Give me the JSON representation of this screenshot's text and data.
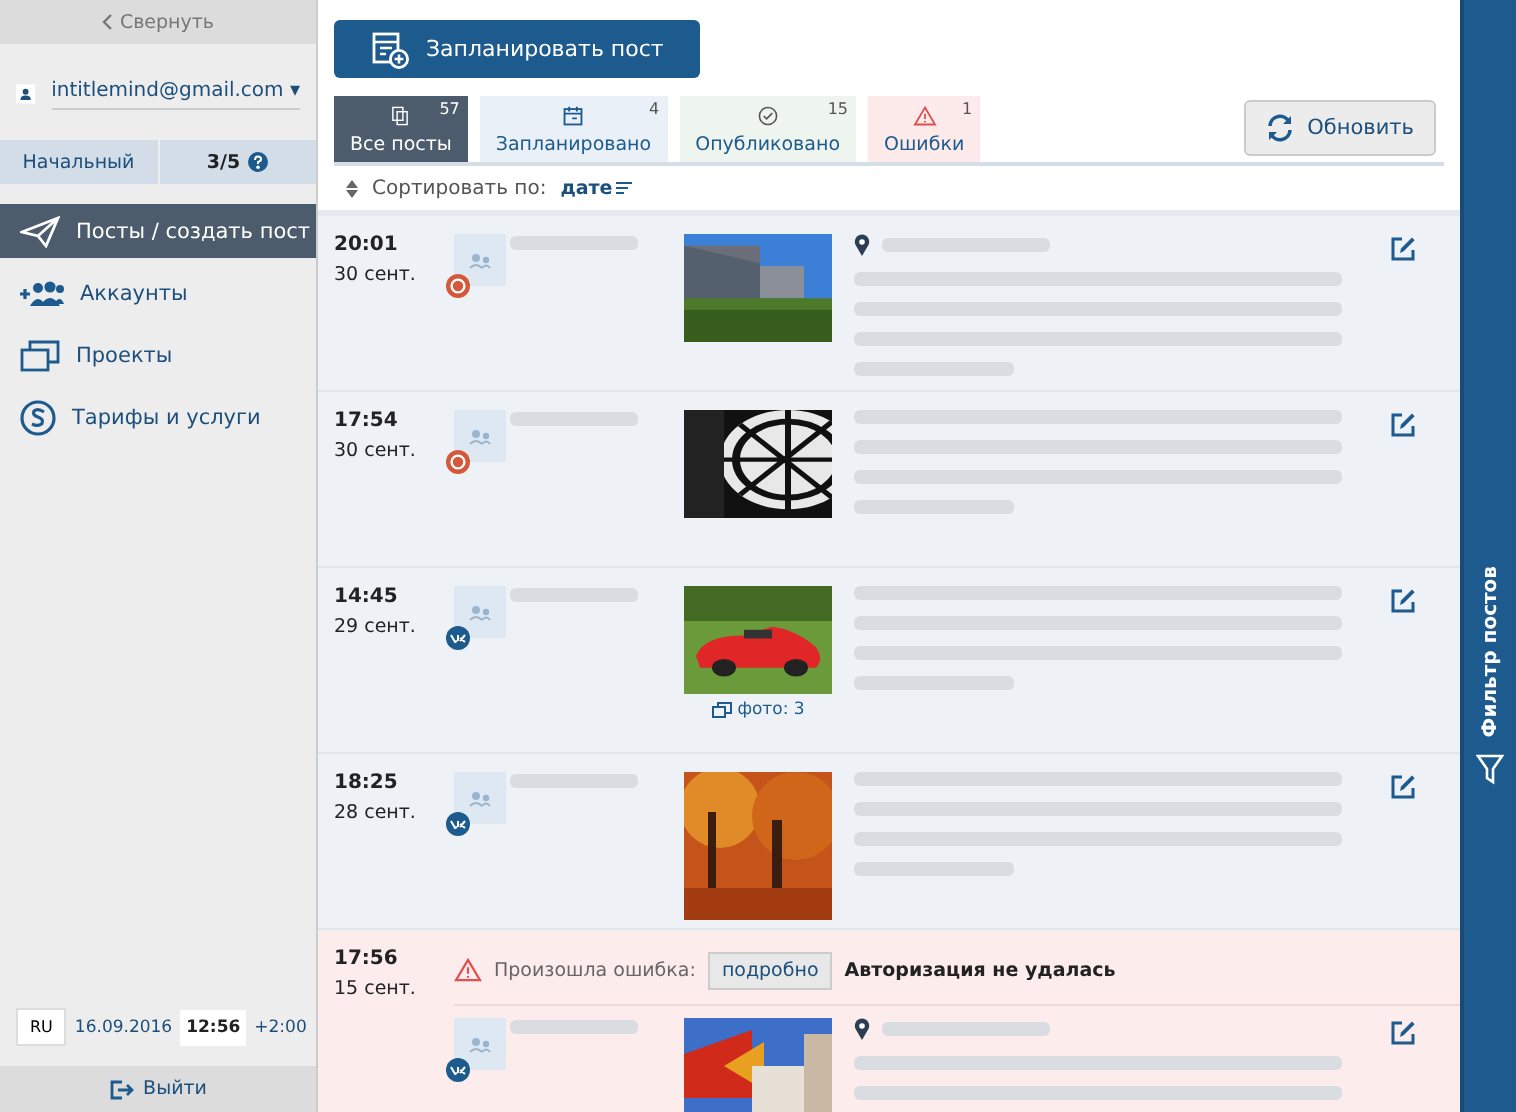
{
  "sidebar": {
    "collapse": "Свернуть",
    "user": {
      "email": "intitlemind@gmail.com",
      "caret": "▾"
    },
    "plan": {
      "name": "Начальный",
      "usage": "3/5"
    },
    "items": [
      {
        "label": "Посты / создать пост",
        "kind": "plane",
        "selected": true
      },
      {
        "label": "Аккаунты",
        "kind": "people",
        "selected": false
      },
      {
        "label": "Проекты",
        "kind": "folders",
        "selected": false
      },
      {
        "label": "Тарифы и услуги",
        "kind": "coin",
        "selected": false
      }
    ],
    "footer": {
      "language": "RU",
      "date": "16.09.2016",
      "time": "12:56",
      "timezone": "+2:00"
    },
    "logout": "Выйти"
  },
  "toolbar": {
    "schedule_button": "Запланировать пост",
    "refresh_button": "Обновить"
  },
  "tabs": [
    {
      "kind": "all",
      "label": "Все посты",
      "count": "57",
      "selected": true
    },
    {
      "kind": "scheduled",
      "label": "Запланировано",
      "count": "4",
      "selected": false
    },
    {
      "kind": "published",
      "label": "Опубликовано",
      "count": "15",
      "selected": false
    },
    {
      "kind": "errors",
      "label": "Ошибки",
      "count": "1",
      "selected": false
    }
  ],
  "sort": {
    "label": "Сортировать по:",
    "value": "дате"
  },
  "posts": [
    {
      "time": "20:01",
      "date": "30 сент.",
      "kind": "ok",
      "location": true,
      "error": false
    },
    {
      "time": "17:54",
      "date": "30 сент.",
      "kind": "ok",
      "location": false,
      "error": false
    },
    {
      "time": "14:45",
      "date": "29 сент.",
      "kind": "vk",
      "location": false,
      "photos": "фото: 3",
      "error": false
    },
    {
      "time": "18:25",
      "date": "28 сент.",
      "kind": "vk",
      "location": false,
      "error": false
    },
    {
      "time": "17:56",
      "date": "15 сент.",
      "kind": "vk",
      "location": true,
      "error": true,
      "error_label": "Произошла ошибка:",
      "error_button": "подробно",
      "error_message": "Авторизация не удалась"
    }
  ],
  "filter_panel": {
    "label": "Фильтр постов"
  }
}
